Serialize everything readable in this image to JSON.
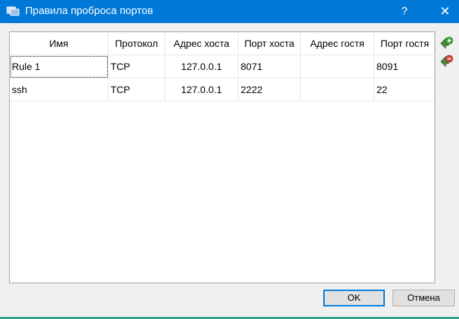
{
  "window": {
    "title": "Правила проброса портов",
    "help_label": "?",
    "close_label": "✕"
  },
  "table": {
    "columns": [
      "Имя",
      "Протокол",
      "Адрес хоста",
      "Порт хоста",
      "Адрес гостя",
      "Порт гостя"
    ],
    "rows": [
      {
        "name": "Rule 1",
        "protocol": "TCP",
        "host_ip": "127.0.0.1",
        "host_port": "8071",
        "guest_ip": "",
        "guest_port": "8091"
      },
      {
        "name": "ssh",
        "protocol": "TCP",
        "host_ip": "127.0.0.1",
        "host_port": "2222",
        "guest_ip": "",
        "guest_port": "22"
      }
    ]
  },
  "side_actions": {
    "add_icon": "add-rule-icon",
    "remove_icon": "remove-rule-icon"
  },
  "buttons": {
    "ok_label": "OK",
    "cancel_label": "Отмена"
  },
  "colors": {
    "titlebar": "#0078d7",
    "default_button_border": "#0078d7",
    "add_icon": "#2e9e3a",
    "remove_icon": "#c63c2e"
  }
}
